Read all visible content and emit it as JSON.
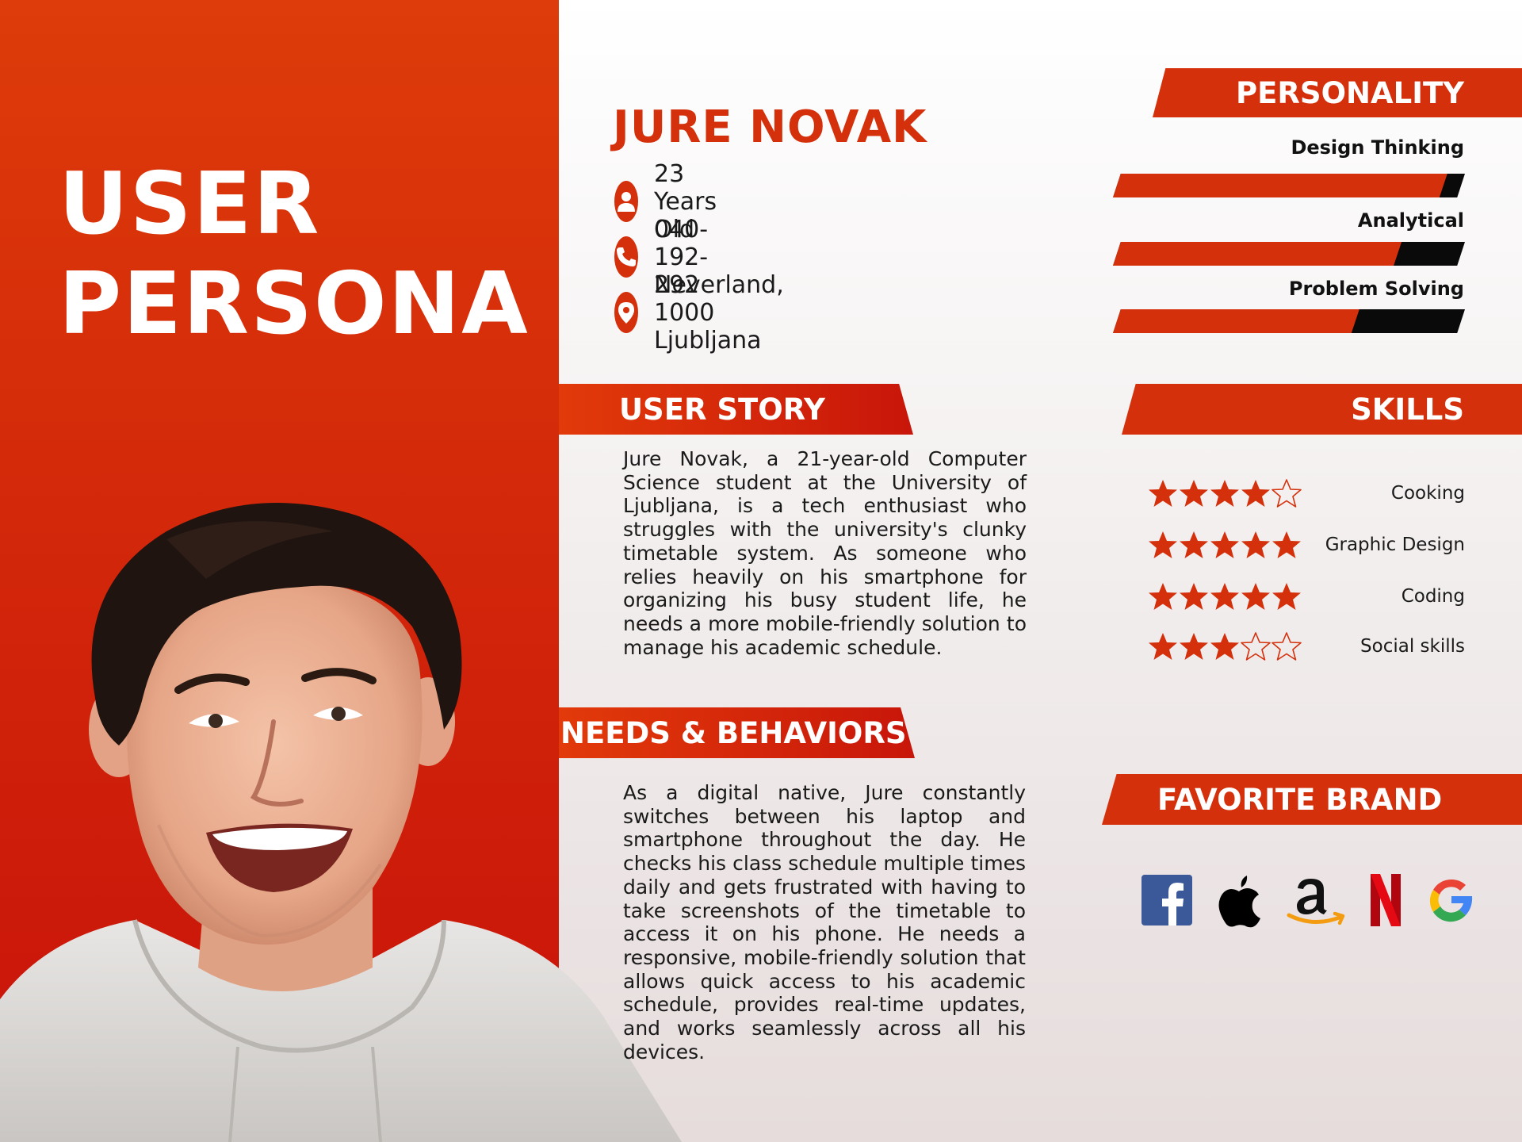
{
  "title_lines": [
    "USER",
    "PERSONA"
  ],
  "persona": {
    "name": "JURE NOVAK",
    "contacts": [
      {
        "icon": "user-icon",
        "text": "23 Years Old"
      },
      {
        "icon": "phone-icon",
        "text": "040-192-292"
      },
      {
        "icon": "location-pin-icon",
        "text": "Neverland, 1000 Ljubljana"
      }
    ]
  },
  "sections": {
    "user_story": {
      "title": "USER STORY",
      "text": "Jure Novak, a 21-year-old Computer Science student at the University of Ljubljana, is a tech enthusiast who struggles with the university's clunky timetable system. As someone who relies heavily on his smartphone for organizing his busy student life, he needs a more mobile-friendly solution to manage his academic schedule."
    },
    "needs": {
      "title": "NEEDS & BEHAVIORS",
      "text": "As a digital native, Jure constantly switches between his laptop and smartphone throughout the day. He checks his class schedule multiple times daily and gets frustrated with having to take screenshots of the timetable to access it on his phone. He needs a responsive, mobile-friendly solution that allows quick access to his academic schedule, provides real-time updates, and works seamlessly across all his devices."
    },
    "personality": {
      "title": "PERSONALITY",
      "traits": [
        {
          "label": "Design Thinking",
          "level": 0.95
        },
        {
          "label": "Analytical",
          "level": 0.82
        },
        {
          "label": "Problem Solving",
          "level": 0.7
        }
      ]
    },
    "skills": {
      "title": "SKILLS",
      "items": [
        {
          "name": "Cooking",
          "rating": 4,
          "max": 5
        },
        {
          "name": "Graphic Design",
          "rating": 5,
          "max": 5
        },
        {
          "name": "Coding",
          "rating": 5,
          "max": 5
        },
        {
          "name": "Social skills",
          "rating": 3,
          "max": 5
        }
      ]
    },
    "brands": {
      "title": "FAVORITE BRAND",
      "items": [
        {
          "icon": "facebook-logo-icon"
        },
        {
          "icon": "apple-logo-icon"
        },
        {
          "icon": "amazon-logo-icon"
        },
        {
          "icon": "netflix-logo-icon"
        },
        {
          "icon": "google-logo-icon"
        }
      ]
    }
  },
  "colors": {
    "accent": "#d4300b",
    "panel_top": "#de3c0a",
    "panel_bottom": "#c8120a",
    "bar_track": "#0a0a0a"
  }
}
